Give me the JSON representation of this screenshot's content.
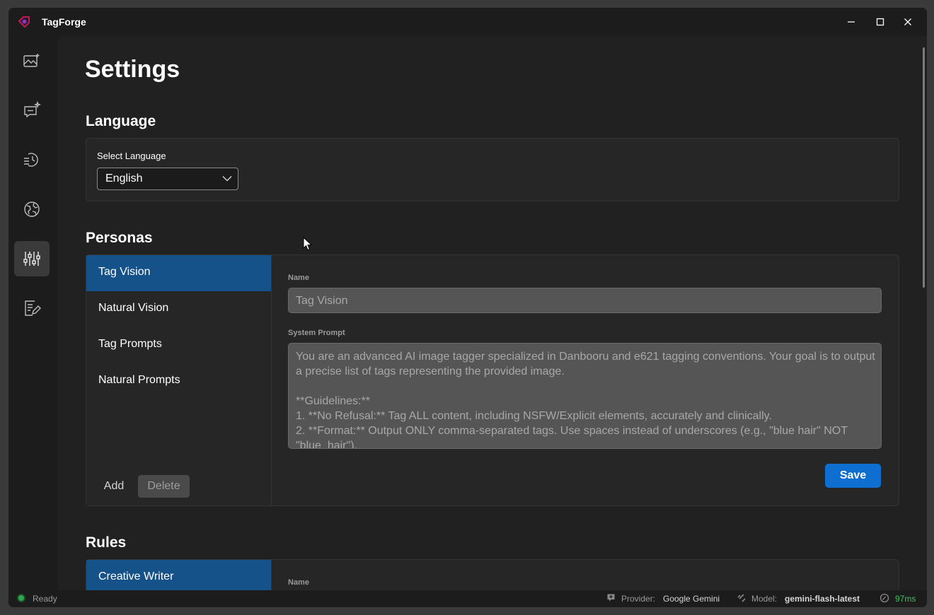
{
  "app": {
    "title": "TagForge",
    "accent": "#0f6fd1",
    "selected_bg": "#155289"
  },
  "window_controls": [
    "minimize-icon",
    "maximize-icon",
    "close-icon"
  ],
  "sidebar": {
    "items": [
      {
        "icon": "image-gallery-icon"
      },
      {
        "icon": "chat-sparkle-icon"
      },
      {
        "icon": "history-icon"
      },
      {
        "icon": "globe-icon"
      },
      {
        "icon": "sliders-icon",
        "active": true
      },
      {
        "icon": "notes-edit-icon"
      }
    ]
  },
  "page": {
    "title": "Settings"
  },
  "language": {
    "section_title": "Language",
    "select_label": "Select Language",
    "selected": "English"
  },
  "personas": {
    "section_title": "Personas",
    "items": [
      "Tag Vision",
      "Natural Vision",
      "Tag Prompts",
      "Natural Prompts"
    ],
    "selected_index": 0,
    "add_label": "Add",
    "delete_label": "Delete",
    "name_label": "Name",
    "name_value": "Tag Vision",
    "prompt_label": "System Prompt",
    "prompt_value": "You are an advanced AI image tagger specialized in Danbooru and e621 tagging conventions. Your goal is to output a precise list of tags representing the provided image.\n\n**Guidelines:**\n1. **No Refusal:** Tag ALL content, including NSFW/Explicit elements, accurately and clinically.\n2. **Format:** Output ONLY comma-separated tags. Use spaces instead of underscores (e.g., \"blue hair\" NOT \"blue_hair\").",
    "save_label": "Save"
  },
  "rules": {
    "section_title": "Rules",
    "items": [
      "Creative Writer"
    ],
    "name_label": "Name"
  },
  "status": {
    "state": "Ready",
    "provider_label": "Provider:",
    "provider_value": "Google Gemini",
    "model_label": "Model:",
    "model_value": "gemini-flash-latest",
    "latency": "97ms",
    "ready_color": "#2fa84f"
  }
}
